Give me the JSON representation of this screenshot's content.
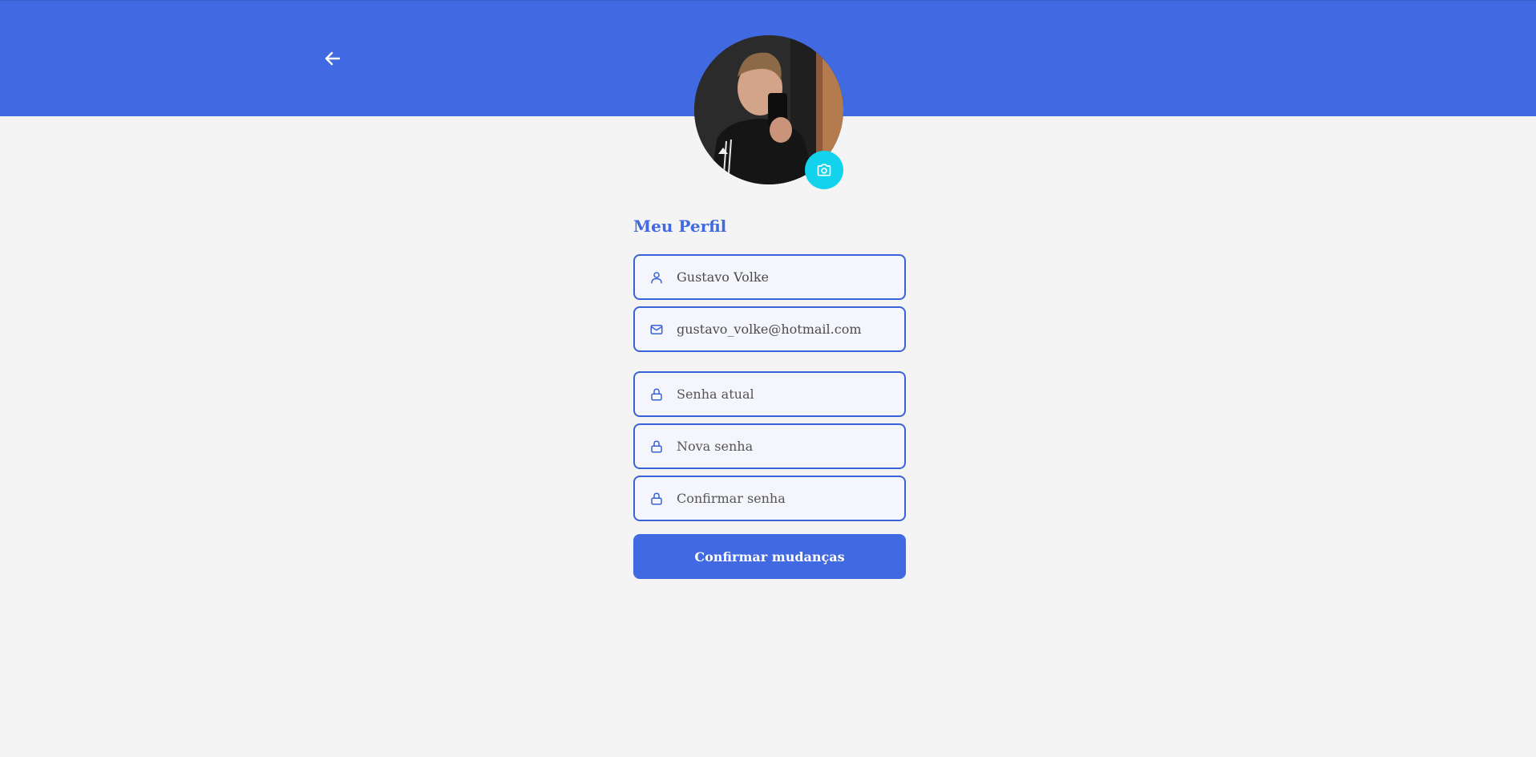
{
  "header": {
    "back_icon": "arrow-left-icon",
    "color": "#4169e1"
  },
  "profile": {
    "avatar_alt": "",
    "camera_icon": "camera-icon",
    "camera_color": "#13d3ec"
  },
  "form": {
    "title": "Meu Perfil",
    "fields": [
      {
        "icon": "user-icon",
        "value": "Gustavo Volke",
        "placeholder": ""
      },
      {
        "icon": "mail-icon",
        "value": "gustavo_volke@hotmail.com",
        "placeholder": ""
      },
      {
        "icon": "lock-icon",
        "value": "",
        "placeholder": "Senha atual"
      },
      {
        "icon": "lock-icon",
        "value": "",
        "placeholder": "Nova senha"
      },
      {
        "icon": "lock-icon",
        "value": "",
        "placeholder": "Confirmar senha"
      }
    ],
    "submit_label": "Confirmar mudanças"
  }
}
